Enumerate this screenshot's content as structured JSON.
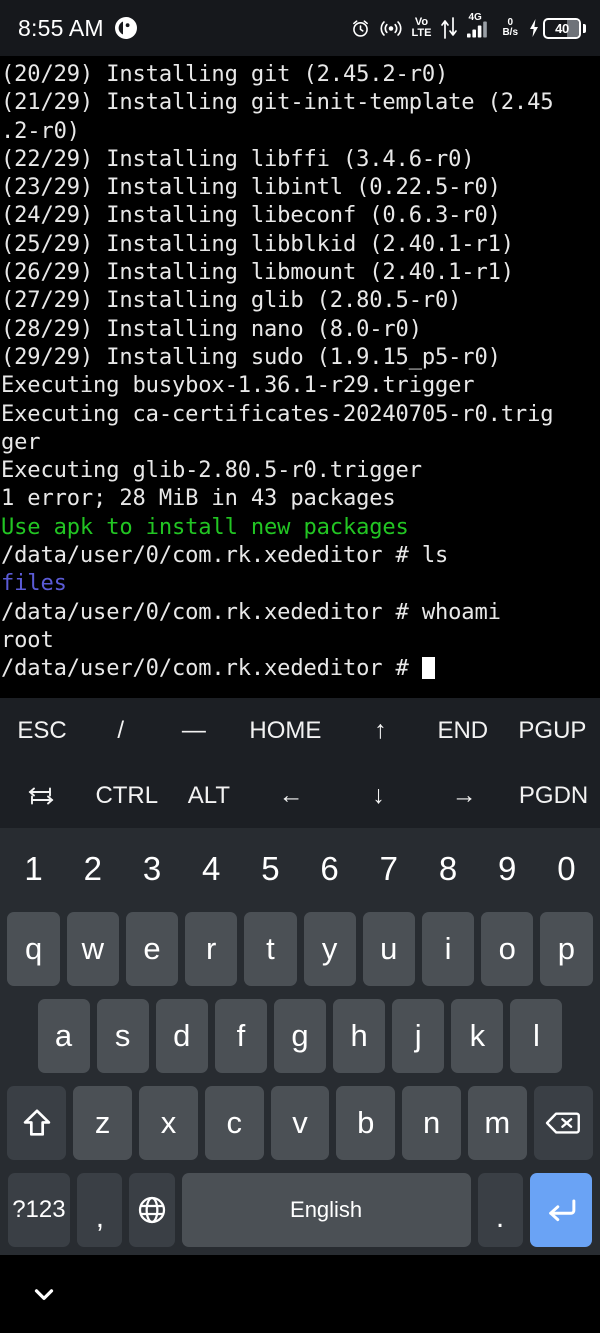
{
  "status_bar": {
    "time": "8:55 AM",
    "app_icon": "notification-app-icon",
    "icons": [
      "alarm-icon",
      "hotspot-icon",
      "volte-icon",
      "data-transfer-icon",
      "signal-4g-icon",
      "network-speed-icon",
      "charging-battery-icon"
    ],
    "volte_top": "Vo",
    "volte_bottom": "LTE",
    "network_speed_value": "0",
    "network_speed_unit": "B/s",
    "signal_gen": "4G",
    "battery_level": "40"
  },
  "terminal": {
    "lines": [
      {
        "text": "(20/29) Installing git (2.45.2-r0)",
        "color": "default"
      },
      {
        "text": "(21/29) Installing git-init-template (2.45",
        "color": "default"
      },
      {
        "text": ".2-r0)",
        "color": "default"
      },
      {
        "text": "(22/29) Installing libffi (3.4.6-r0)",
        "color": "default"
      },
      {
        "text": "(23/29) Installing libintl (0.22.5-r0)",
        "color": "default"
      },
      {
        "text": "(24/29) Installing libeconf (0.6.3-r0)",
        "color": "default"
      },
      {
        "text": "(25/29) Installing libblkid (2.40.1-r1)",
        "color": "default"
      },
      {
        "text": "(26/29) Installing libmount (2.40.1-r1)",
        "color": "default"
      },
      {
        "text": "(27/29) Installing glib (2.80.5-r0)",
        "color": "default"
      },
      {
        "text": "(28/29) Installing nano (8.0-r0)",
        "color": "default"
      },
      {
        "text": "(29/29) Installing sudo (1.9.15_p5-r0)",
        "color": "default"
      },
      {
        "text": "Executing busybox-1.36.1-r29.trigger",
        "color": "default"
      },
      {
        "text": "Executing ca-certificates-20240705-r0.trig",
        "color": "default"
      },
      {
        "text": "ger",
        "color": "default"
      },
      {
        "text": "Executing glib-2.80.5-r0.trigger",
        "color": "default"
      },
      {
        "text": "1 error; 28 MiB in 43 packages",
        "color": "default"
      },
      {
        "text": "Use apk to install new packages",
        "color": "green"
      },
      {
        "text": "/data/user/0/com.rk.xededitor # ls",
        "color": "default"
      },
      {
        "text": "files",
        "color": "blue"
      },
      {
        "text": "/data/user/0/com.rk.xededitor # whoami",
        "color": "default"
      },
      {
        "text": "root",
        "color": "default"
      },
      {
        "text": "/data/user/0/com.rk.xededitor # ",
        "color": "default",
        "cursor": true
      }
    ]
  },
  "keyboard": {
    "function_row_1": [
      {
        "label": "ESC",
        "name": "key-esc",
        "flex": 1.15
      },
      {
        "label": "/",
        "name": "key-slash",
        "flex": 1.0
      },
      {
        "label": "—",
        "name": "key-dash",
        "flex": 1.0
      },
      {
        "label": "HOME",
        "name": "key-home",
        "flex": 1.5
      },
      {
        "label": "↑",
        "name": "key-arrow-up",
        "flex": 1.1
      },
      {
        "label": "END",
        "name": "key-end",
        "flex": 1.15
      },
      {
        "label": "PGUP",
        "name": "key-pgup",
        "flex": 1.3
      }
    ],
    "function_row_2": [
      {
        "label": "⇥",
        "name": "key-tab",
        "flex": 1.15,
        "icon": "tab-icon"
      },
      {
        "label": "CTRL",
        "name": "key-ctrl",
        "flex": 1.25
      },
      {
        "label": "ALT",
        "name": "key-alt",
        "flex": 1.05
      },
      {
        "label": "←",
        "name": "key-arrow-left",
        "flex": 1.25
      },
      {
        "label": "↓",
        "name": "key-arrow-down",
        "flex": 1.2
      },
      {
        "label": "→",
        "name": "key-arrow-right",
        "flex": 1.2
      },
      {
        "label": "PGDN",
        "name": "key-pgdn",
        "flex": 1.3
      }
    ],
    "number_row": [
      "1",
      "2",
      "3",
      "4",
      "5",
      "6",
      "7",
      "8",
      "9",
      "0"
    ],
    "row_q": [
      "q",
      "w",
      "e",
      "r",
      "t",
      "y",
      "u",
      "i",
      "o",
      "p"
    ],
    "row_a": [
      "a",
      "s",
      "d",
      "f",
      "g",
      "h",
      "j",
      "k",
      "l"
    ],
    "row_z": [
      "z",
      "x",
      "c",
      "v",
      "b",
      "n",
      "m"
    ],
    "shift_label": "shift",
    "backspace_label": "backspace",
    "symbols_label": "?123",
    "comma_label": ",",
    "language_label": "language",
    "space_label": "English",
    "period_label": ".",
    "enter_label": "enter",
    "accent_color": "#6aa3f5"
  },
  "nav_bar": {
    "hide_keyboard_label": "hide-keyboard"
  }
}
